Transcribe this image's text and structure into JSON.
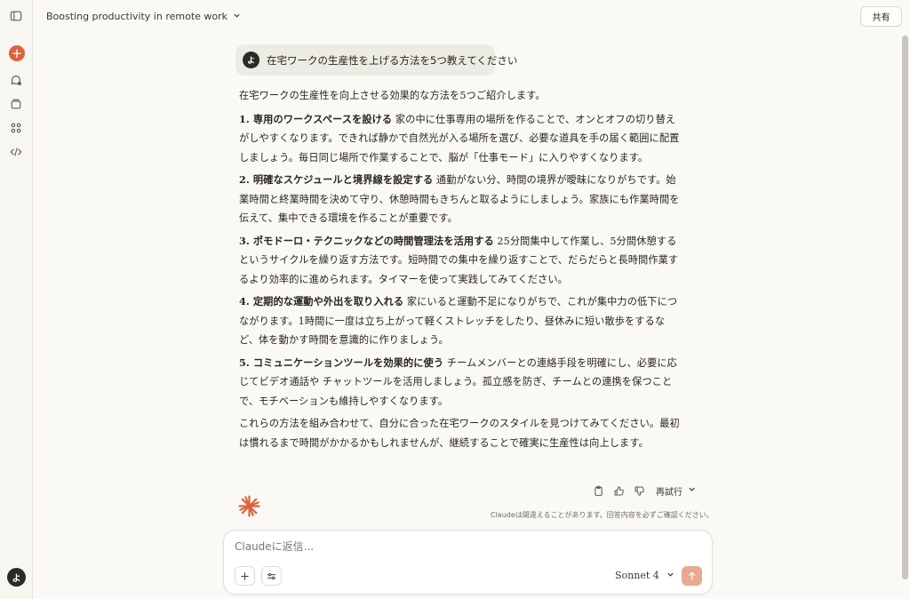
{
  "header": {
    "title": "Boosting productivity in remote work",
    "share_label": "共有"
  },
  "sidebar": {
    "new_chat_icon": "+",
    "user_initial": "よ"
  },
  "user_message": {
    "avatar_initial": "よ",
    "text": "在宅ワークの生産性を上げる方法を5つ教えてください"
  },
  "response": {
    "intro": "在宅ワークの生産性を向上させる効果的な方法を5つご紹介します。",
    "items": [
      {
        "heading": "1. 専用のワークスペースを設ける",
        "body": " 家の中に仕事専用の場所を作ることで、オンとオフの切り替えがしやすくなります。できれば静かで自然光が入る場所を選び、必要な道具を手の届く範囲に配置しましょう。毎日同じ場所で作業することで、脳が「仕事モード」に入りやすくなります。"
      },
      {
        "heading": "2. 明確なスケジュールと境界線を設定する",
        "body": " 通勤がない分、時間の境界が曖昧になりがちです。始業時間と終業時間を決めて守り、休憩時間もきちんと取るようにしましょう。家族にも作業時間を伝えて、集中できる環境を作ることが重要です。"
      },
      {
        "heading": "3. ポモドーロ・テクニックなどの時間管理法を活用する",
        "body": " 25分間集中して作業し、5分間休憩するというサイクルを繰り返す方法です。短時間での集中を繰り返すことで、だらだらと長時間作業するより効率的に進められます。タイマーを使って実践してみてください。"
      },
      {
        "heading": "4. 定期的な運動や外出を取り入れる",
        "body": " 家にいると運動不足になりがちで、これが集中力の低下につながります。1時間に一度は立ち上がって軽くストレッチをしたり、昼休みに短い散歩をするなど、体を動かす時間を意識的に作りましょう。"
      },
      {
        "heading": "5. コミュニケーションツールを効果的に使う",
        "body": " チームメンバーとの連絡手段を明確にし、必要に応じてビデオ通話や チャットツールを活用しましょう。孤立感を防ぎ、チームとの連携を保つことで、モチベーションも維持しやすくなります。"
      }
    ],
    "outro": "これらの方法を組み合わせて、自分に合った在宅ワークのスタイルを見つけてみてください。最初は慣れるまで時間がかかるかもしれませんが、継続することで確実に生産性は向上します。"
  },
  "actions": {
    "retry_label": "再試行",
    "disclaimer": "Claudeは間違えることがあります。回答内容を必ずご確認ください。"
  },
  "composer": {
    "placeholder": "Claudeに返信...",
    "model": "Sonnet 4"
  },
  "colors": {
    "accent": "#d9643f",
    "send_disabled": "#e8a891",
    "background": "#faf9f5"
  }
}
